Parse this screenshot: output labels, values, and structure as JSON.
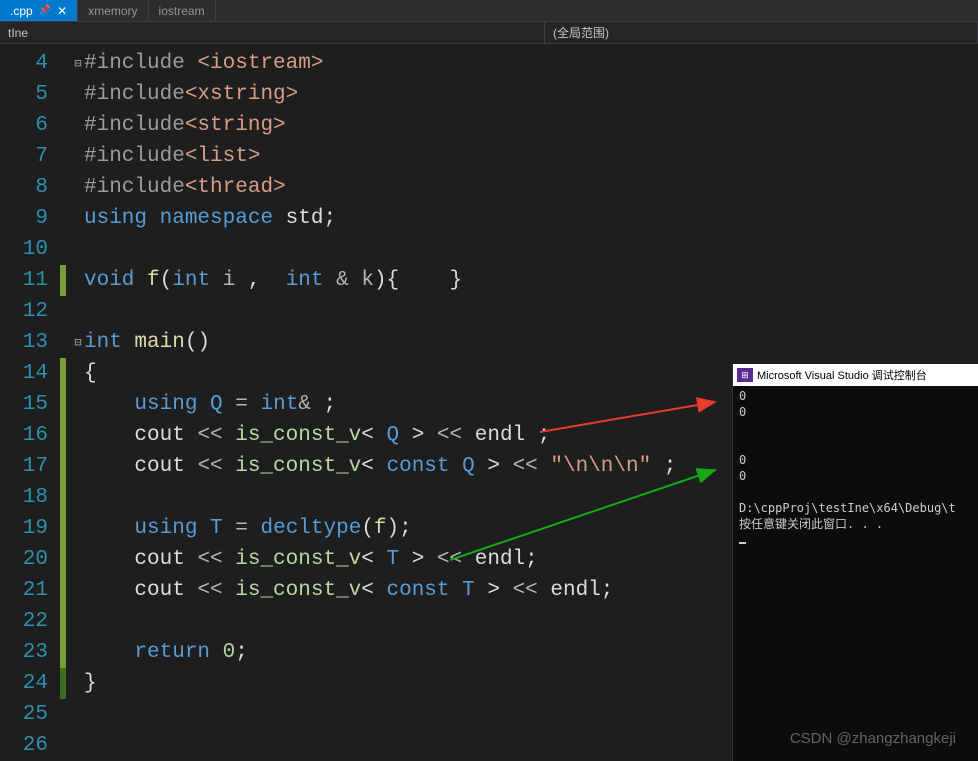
{
  "tabs": [
    {
      "label": ".cpp",
      "active": true,
      "pinned": true,
      "closeable": true
    },
    {
      "label": "xmemory",
      "active": false
    },
    {
      "label": "iostream",
      "active": false
    }
  ],
  "scope": {
    "left": "tIne",
    "right": "(全局范围)"
  },
  "line_start": 4,
  "line_end": 26,
  "code": {
    "l4": {
      "pp": "#include ",
      "inc": "<iostream>"
    },
    "l5": {
      "pp": "#include",
      "inc": "<xstring>"
    },
    "l6": {
      "pp": "#include",
      "inc": "<string>"
    },
    "l7": {
      "pp": "#include",
      "inc": "<list>"
    },
    "l8": {
      "pp": "#include",
      "inc": "<thread>"
    },
    "l9": {
      "kw1": "using ",
      "kw2": "namespace ",
      "id": "std",
      "t": ";"
    },
    "l11": {
      "kw": "void ",
      "fn": "f",
      "p1": "(",
      "t1": "int ",
      "a1": "i",
      "c": " ,  ",
      "t2": "int ",
      "amp": "& ",
      "a2": "k",
      "p2": "){    }"
    },
    "l13": {
      "t": "int ",
      "fn": "main",
      "p": "()"
    },
    "l14": {
      "p": "{"
    },
    "l15": {
      "kw": "using ",
      "id": "Q ",
      "eq": "= ",
      "t": "int",
      "amp": "& ",
      "sc": ";"
    },
    "l16": {
      "id": "cout ",
      "op1": "<< ",
      "tpl": "is_const_v",
      "lt": "< ",
      "T": "Q ",
      "gt": "> ",
      "op2": "<< ",
      "e": "endl ",
      "sc": ";"
    },
    "l17": {
      "id": "cout ",
      "op1": "<< ",
      "tpl": "is_const_v",
      "lt": "< ",
      "cv": "const ",
      "T": "Q ",
      "gt": "> ",
      "op2": "<< ",
      "s": "\"\\n\\n\\n\" ",
      "sc": ";"
    },
    "l19": {
      "kw": "using ",
      "id": "T ",
      "eq": "= ",
      "dt": "decltype",
      "p1": "(",
      "fn": "f",
      "p2": ");"
    },
    "l20": {
      "id": "cout ",
      "op1": "<< ",
      "tpl": "is_const_v",
      "lt": "< ",
      "T": "T ",
      "gt": "> ",
      "op2": "<< ",
      "e": "endl",
      "sc": ";"
    },
    "l21": {
      "id": "cout ",
      "op1": "<< ",
      "tpl": "is_const_v",
      "lt": "< ",
      "cv": "const ",
      "T": "T ",
      "gt": "> ",
      "op2": "<< ",
      "e": "endl",
      "sc": ";"
    },
    "l23": {
      "kw": "return ",
      "n": "0",
      "sc": ";"
    },
    "l24": {
      "p": "}"
    }
  },
  "console": {
    "title": "Microsoft Visual Studio 调试控制台",
    "badge": "⧉",
    "lines": [
      "0",
      "0",
      "",
      "",
      "0",
      "0",
      "",
      "D:\\cppProj\\testIne\\x64\\Debug\\t",
      "按任意键关闭此窗口. . ."
    ]
  },
  "watermark": "CSDN @zhangzhangkeji"
}
